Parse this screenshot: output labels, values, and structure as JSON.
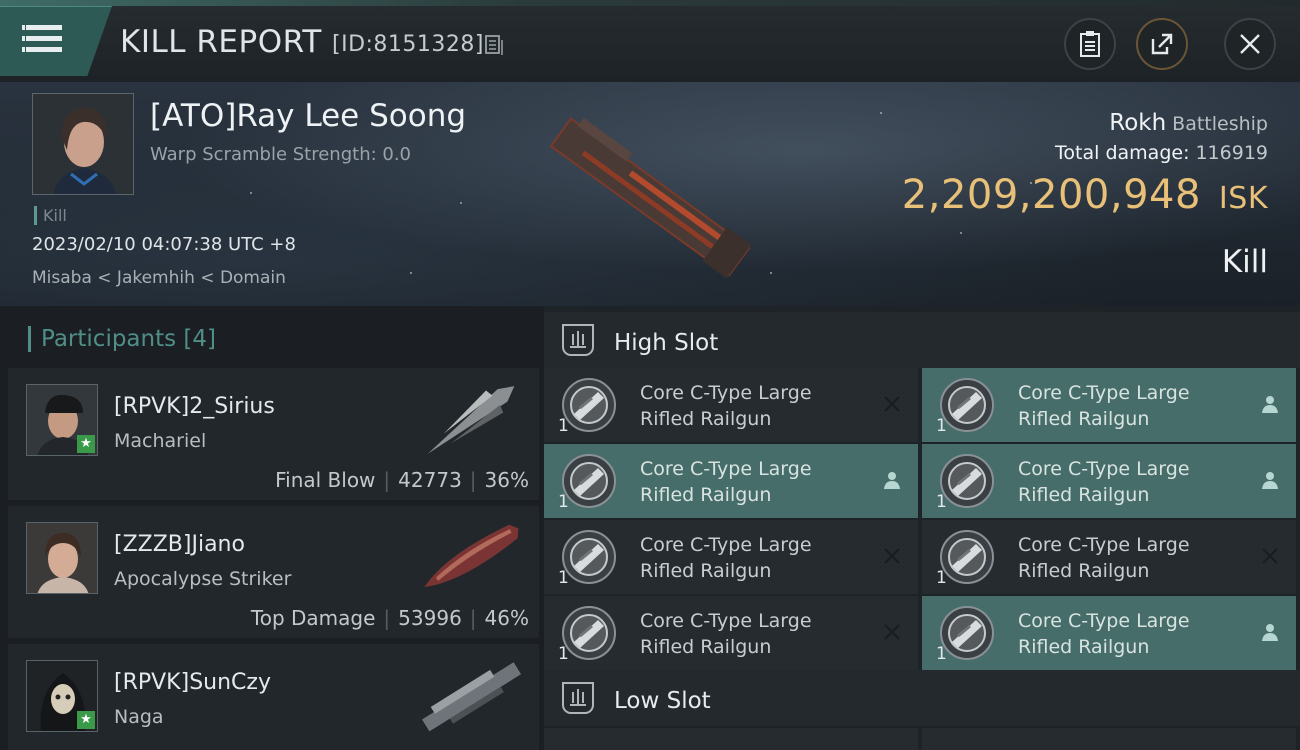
{
  "header": {
    "title": "KILL REPORT",
    "report_id": "[ID:8151328]"
  },
  "victim": {
    "name": "[ATO]Ray Lee Soong",
    "warp_scramble": "Warp Scramble Strength: 0.0",
    "kill_tag": "Kill",
    "datetime": "2023/02/10 04:07:38 UTC +8",
    "location": "Misaba < Jakemhih < Domain",
    "ship_name": "Rokh",
    "ship_class": "Battleship",
    "total_damage_label": "Total damage:",
    "total_damage": "116919",
    "isk_value": "2,209,200,948",
    "isk_unit": "ISK",
    "result": "Kill"
  },
  "participants": {
    "label": "Participants",
    "count": "[4]",
    "items": [
      {
        "name": "[RPVK]2_Sirius",
        "ship": "Machariel",
        "role": "Final Blow",
        "damage": "42773",
        "percent": "36%"
      },
      {
        "name": "[ZZZB]Jiano",
        "ship": "Apocalypse Striker",
        "role": "Top Damage",
        "damage": "53996",
        "percent": "46%"
      },
      {
        "name": "[RPVK]SunCzy",
        "ship": "Naga"
      }
    ]
  },
  "fitting": {
    "high_slot_label": "High Slot",
    "low_slot_label": "Low Slot",
    "modules": [
      {
        "line1": "Core C-Type Large",
        "line2": "Rifled Railgun",
        "qty": "1",
        "state": "destroyed"
      },
      {
        "line1": "Core C-Type Large",
        "line2": "Rifled Railgun",
        "qty": "1",
        "state": "dropped"
      },
      {
        "line1": "Core C-Type Large",
        "line2": "Rifled Railgun",
        "qty": "1",
        "state": "dropped"
      },
      {
        "line1": "Core C-Type Large",
        "line2": "Rifled Railgun",
        "qty": "1",
        "state": "dropped"
      },
      {
        "line1": "Core C-Type Large",
        "line2": "Rifled Railgun",
        "qty": "1",
        "state": "destroyed"
      },
      {
        "line1": "Core C-Type Large",
        "line2": "Rifled Railgun",
        "qty": "1",
        "state": "destroyed"
      },
      {
        "line1": "Core C-Type Large",
        "line2": "Rifled Railgun",
        "qty": "1",
        "state": "destroyed"
      },
      {
        "line1": "Core C-Type Large",
        "line2": "Rifled Railgun",
        "qty": "1",
        "state": "dropped"
      }
    ]
  },
  "colors": {
    "accent": "#466d69",
    "isk": "#e9c078",
    "share_ring": "#6a5635"
  },
  "icons": {
    "menu": "hamburger-icon",
    "copy": "copy-icon",
    "clipboard": "clipboard-icon",
    "share": "share-icon",
    "close": "close-icon",
    "destroyed": "x-icon",
    "dropped": "person-icon"
  }
}
